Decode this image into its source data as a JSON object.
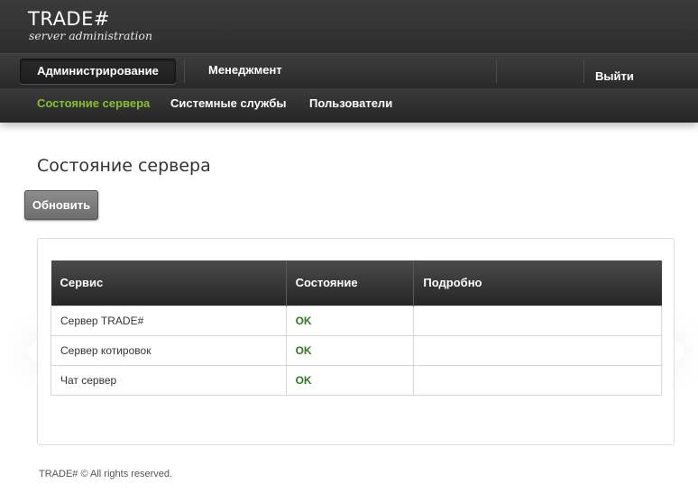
{
  "brand": {
    "title": "TRADE#",
    "subtitle": "server administration"
  },
  "topnav": {
    "items": [
      {
        "label": "Администрирование",
        "active": true
      },
      {
        "label": "Менеджмент",
        "active": false
      }
    ],
    "logout_label": "Выйти"
  },
  "subnav": {
    "items": [
      {
        "label": "Состояние сервера",
        "active": true
      },
      {
        "label": "Системные службы",
        "active": false
      },
      {
        "label": "Пользователи",
        "active": false
      }
    ]
  },
  "page": {
    "title": "Состояние сервера",
    "refresh_label": "Обновить"
  },
  "table": {
    "columns": [
      "Сервис",
      "Состояние",
      "Подробно"
    ],
    "rows": [
      {
        "service": "Сервер TRADE#",
        "status": "OK",
        "details": ""
      },
      {
        "service": "Сервер котировок",
        "status": "OK",
        "details": ""
      },
      {
        "service": "Чат сервер",
        "status": "OK",
        "details": ""
      }
    ]
  },
  "footer": {
    "text": "TRADE# © All rights reserved."
  },
  "colors": {
    "active_subnav": "#8bbd2e",
    "status_ok": "#2f7a1c",
    "header_bg": "#333333"
  }
}
